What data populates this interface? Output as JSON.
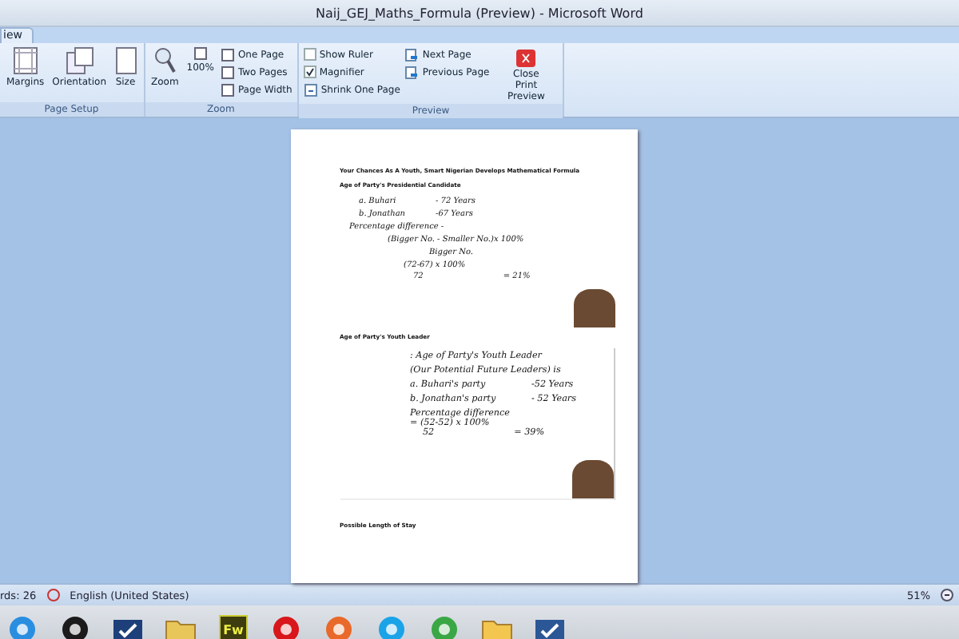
{
  "window": {
    "title": "Naij_GEJ_Maths_Formula (Preview) - Microsoft Word"
  },
  "tabs": [
    {
      "label": "iew",
      "selected": true
    }
  ],
  "ribbon": {
    "groups": [
      {
        "title": "Page Setup",
        "items": [
          {
            "kind": "big",
            "label": "Margins"
          },
          {
            "kind": "big",
            "label": "Orientation"
          },
          {
            "kind": "big",
            "label": "Size"
          }
        ]
      },
      {
        "title": "Zoom",
        "items": [
          {
            "kind": "big",
            "label": "Zoom"
          },
          {
            "kind": "big",
            "label": "100%"
          },
          {
            "kind": "small",
            "label": "One Page"
          },
          {
            "kind": "small",
            "label": "Two Pages"
          },
          {
            "kind": "small",
            "label": "Page Width"
          }
        ]
      },
      {
        "title": "Preview",
        "items": [
          {
            "kind": "check",
            "label": "Show Ruler",
            "checked": false
          },
          {
            "kind": "check",
            "label": "Magnifier",
            "checked": true
          },
          {
            "kind": "small",
            "label": "Shrink One Page"
          },
          {
            "kind": "small",
            "label": "Next Page"
          },
          {
            "kind": "small",
            "label": "Previous Page"
          },
          {
            "kind": "close",
            "label": "Close Print Preview"
          }
        ]
      }
    ]
  },
  "document": {
    "heading": "Your Chances As A Youth, Smart Nigerian Develops Mathematical Formula",
    "section_1": {
      "title": "Age of Party's Presidential Candidate",
      "rows": [
        [
          "a. Buhari",
          "- 72 Years"
        ],
        [
          "b. Jonathan",
          "-67 Years"
        ]
      ],
      "label": "Percentage difference -",
      "formula": "(Bigger No. - Smaller No.)x 100%",
      "denominator": "Bigger No.",
      "calc": "(72-67) x 100%",
      "calc_den": "72",
      "result": "= 21%"
    },
    "section_2": {
      "title": "Age of Party's Youth Leader",
      "lines": [
        ": Age of Party's Youth Leader",
        "(Our Potential Future Leaders) is"
      ],
      "rows": [
        [
          "a. Buhari's party",
          "-52 Years"
        ],
        [
          "b. Jonathan's party",
          "- 52 Years"
        ]
      ],
      "label": "Percentage difference",
      "calc": "= (52-52) x 100%",
      "calc_den": "52",
      "result": "= 39%"
    },
    "section_3": {
      "title": "Possible Length of Stay"
    }
  },
  "status_bar": {
    "words": "rds: 26",
    "language": "English (United States)",
    "zoom": "51%"
  },
  "taskbar": {
    "apps": [
      {
        "kind": "ie"
      },
      {
        "kind": "hp"
      },
      {
        "kind": "check"
      },
      {
        "kind": "folder"
      },
      {
        "kind": "fw",
        "label": "Fw"
      },
      {
        "kind": "opera"
      },
      {
        "kind": "firefox"
      },
      {
        "kind": "skype"
      },
      {
        "kind": "chrome"
      },
      {
        "kind": "outlook"
      },
      {
        "kind": "word"
      }
    ]
  }
}
